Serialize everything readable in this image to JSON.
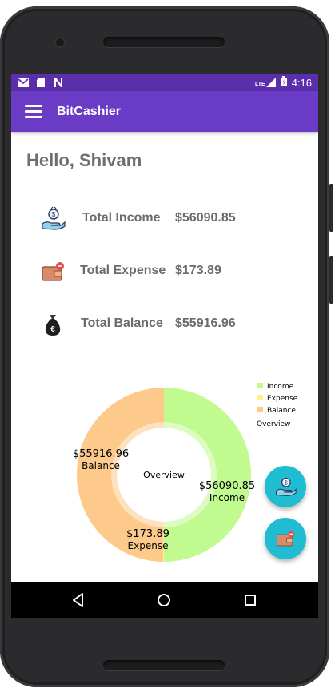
{
  "status_bar": {
    "network": "LTE",
    "time": "4:16"
  },
  "app_bar": {
    "title": "BitCashier"
  },
  "greeting": "Hello, Shivam",
  "summary": [
    {
      "label": "Total Income",
      "value": "$56090.85",
      "icon": "money-hand-icon"
    },
    {
      "label": "Total Expense",
      "value": "$173.89",
      "icon": "wallet-icon"
    },
    {
      "label": "Total Balance",
      "value": "$55916.96",
      "icon": "money-bag-icon"
    }
  ],
  "chart_data": {
    "type": "pie",
    "title": "",
    "center_text": "Overview",
    "legend_position": "top-right",
    "legend_entries": [
      "Income",
      "Expense",
      "Balance"
    ],
    "legend_caption": "Overview",
    "slices": [
      {
        "name": "Income",
        "value": 56090.85,
        "label": "$56090.85",
        "color": "#c1fa8e"
      },
      {
        "name": "Expense",
        "value": 173.89,
        "label": "$173.89",
        "color": "#fbf58a"
      },
      {
        "name": "Balance",
        "value": 55916.96,
        "label": "$55916.96",
        "color": "#fdca8b"
      }
    ]
  },
  "colors": {
    "status_bar": "#5b2fab",
    "app_bar": "#6a3bc4",
    "fab": "#1fbcd2",
    "text_gray": "#6b6b6b"
  },
  "fabs": [
    {
      "icon": "money-hand-icon"
    },
    {
      "icon": "wallet-icon"
    }
  ],
  "nav": [
    "back-icon",
    "home-icon",
    "recents-icon"
  ]
}
